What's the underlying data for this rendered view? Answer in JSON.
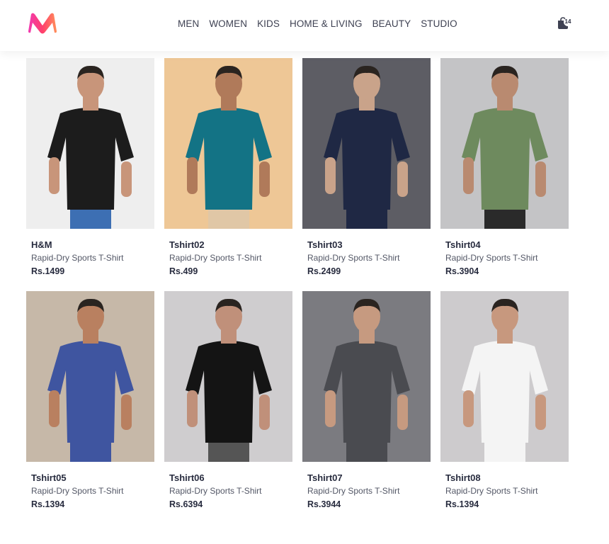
{
  "header": {
    "nav": [
      "MEN",
      "WOMEN",
      "KIDS",
      "HOME & LIVING",
      "BEAUTY",
      "STUDIO"
    ],
    "bag_count": "14",
    "logo_colors": [
      "#ff3f6c",
      "#f13ab1",
      "#ff905a"
    ]
  },
  "products": [
    {
      "brand": "H&M",
      "desc": "Rapid-Dry Sports T-Shirt",
      "price": "Rs.1499",
      "bg": "#eeeeee",
      "shirt": "#1c1c1c",
      "skin": "#c8957a",
      "pants": "#3d6fb3"
    },
    {
      "brand": "Tshirt02",
      "desc": "Rapid-Dry Sports T-Shirt",
      "price": "Rs.499",
      "bg": "#eec796",
      "shirt": "#137385",
      "skin": "#b07a5a",
      "pants": "#e0c7a6"
    },
    {
      "brand": "Tshirt03",
      "desc": "Rapid-Dry Sports T-Shirt",
      "price": "Rs.2499",
      "bg": "#5d5d64",
      "shirt": "#1f2844",
      "skin": "#c9a38a",
      "pants": "#1f2844"
    },
    {
      "brand": "Tshirt04",
      "desc": "Rapid-Dry Sports T-Shirt",
      "price": "Rs.3904",
      "bg": "#c4c4c6",
      "shirt": "#6e8a5e",
      "skin": "#b98a70",
      "pants": "#2a2a2a"
    },
    {
      "brand": "Tshirt05",
      "desc": "Rapid-Dry Sports T-Shirt",
      "price": "Rs.1394",
      "bg": "#c6b8a8",
      "shirt": "#3f55a0",
      "skin": "#b98060",
      "pants": "#3f55a0"
    },
    {
      "brand": "Tshirt06",
      "desc": "Rapid-Dry Sports T-Shirt",
      "price": "Rs.6394",
      "bg": "#cfcdcf",
      "shirt": "#141414",
      "skin": "#c0907a",
      "pants": "#555555"
    },
    {
      "brand": "Tshirt07",
      "desc": "Rapid-Dry Sports T-Shirt",
      "price": "Rs.3944",
      "bg": "#7b7b80",
      "shirt": "#4a4b50",
      "skin": "#c69a80",
      "pants": "#4a4b50"
    },
    {
      "brand": "Tshirt08",
      "desc": "Rapid-Dry Sports T-Shirt",
      "price": "Rs.1394",
      "bg": "#cdcbcd",
      "shirt": "#f4f4f4",
      "skin": "#c7987e",
      "pants": "#f4f4f4"
    }
  ]
}
